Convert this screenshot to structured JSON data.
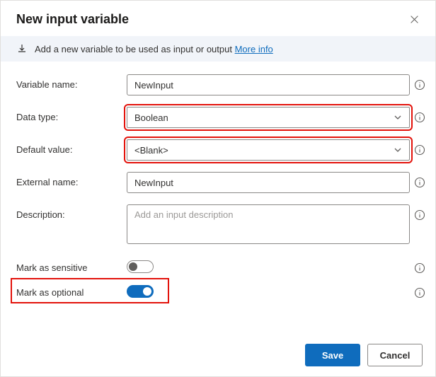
{
  "dialog": {
    "title": "New input variable"
  },
  "banner": {
    "text": "Add a new variable to be used as input or output ",
    "link_label": "More info"
  },
  "form": {
    "variable_name_label": "Variable name:",
    "variable_name_value": "NewInput",
    "data_type_label": "Data type:",
    "data_type_value": "Boolean",
    "default_value_label": "Default value:",
    "default_value_value": "<Blank>",
    "external_name_label": "External name:",
    "external_name_value": "NewInput",
    "description_label": "Description:",
    "description_placeholder": "Add an input description",
    "mark_sensitive_label": "Mark as sensitive",
    "mark_sensitive_on": false,
    "mark_optional_label": "Mark as optional",
    "mark_optional_on": true
  },
  "footer": {
    "save_label": "Save",
    "cancel_label": "Cancel"
  }
}
